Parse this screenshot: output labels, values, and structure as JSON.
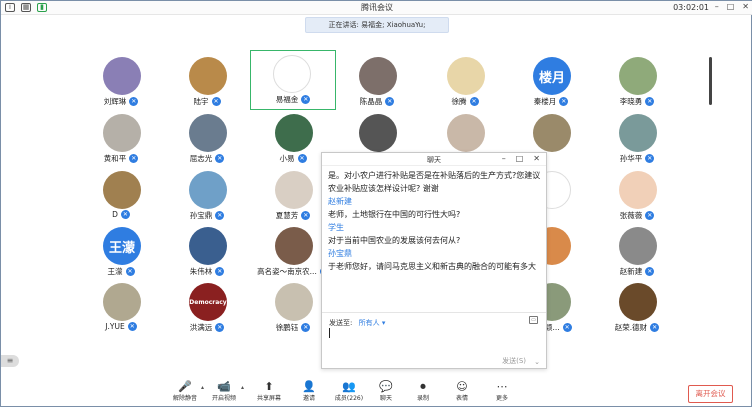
{
  "window": {
    "title": "腾讯会议",
    "time": "03:02:01"
  },
  "speaking_banner": "正在讲话: 易福金; XiaohuaYu;",
  "colors": {
    "accent": "#2f7de1",
    "active_border": "#38b66a",
    "leave_red": "#e05a4f"
  },
  "participants": [
    {
      "name": "刘辉琳",
      "bg": "#8a7fb5",
      "label": ""
    },
    {
      "name": "陆宇",
      "bg": "#b98a4a",
      "label": ""
    },
    {
      "name": "易福金",
      "bg": "#ffffff",
      "label": "",
      "active": true
    },
    {
      "name": "陈晶晶",
      "bg": "#7d6f6a",
      "label": ""
    },
    {
      "name": "徐腾",
      "bg": "#e8d6a8",
      "label": ""
    },
    {
      "name": "秦楼月",
      "bg": "#2f7de1",
      "label": "楼月"
    },
    {
      "name": "李晓勇",
      "bg": "#8faa7a",
      "label": ""
    },
    {
      "name": "黄和平",
      "bg": "#b5b0a8",
      "label": ""
    },
    {
      "name": "屈志光",
      "bg": "#6a7c8f",
      "label": ""
    },
    {
      "name": "小易",
      "bg": "#3e6d4c",
      "label": ""
    },
    {
      "name": "",
      "bg": "#555555",
      "label": ""
    },
    {
      "name": "",
      "bg": "#c9b8a8",
      "label": ""
    },
    {
      "name": "",
      "bg": "#9a8a6a",
      "label": ""
    },
    {
      "name": "孙华平",
      "bg": "#7a9a9a",
      "label": ""
    },
    {
      "name": "D",
      "bg": "#a08050",
      "label": ""
    },
    {
      "name": "孙宝鼎",
      "bg": "#6fa0c8",
      "label": ""
    },
    {
      "name": "夏慧芳",
      "bg": "#d9cfc4",
      "label": ""
    },
    {
      "name": "",
      "bg": "#ffffff",
      "label": ""
    },
    {
      "name": "",
      "bg": "#ffffff",
      "label": ""
    },
    {
      "name": "",
      "bg": "#ffffff",
      "label": ""
    },
    {
      "name": "张薇薇",
      "bg": "#f1d0b8",
      "label": ""
    },
    {
      "name": "王濛",
      "bg": "#2f7de1",
      "label": "王濛"
    },
    {
      "name": "朱伟林",
      "bg": "#3a5f8f",
      "label": ""
    },
    {
      "name": "高名姿～南京农...",
      "bg": "#7a5c4a",
      "label": ""
    },
    {
      "name": "",
      "bg": "#ffffff",
      "label": ""
    },
    {
      "name": "",
      "bg": "#ffffff",
      "label": ""
    },
    {
      "name": "",
      "bg": "#d98a4a",
      "label": ""
    },
    {
      "name": "赵新建",
      "bg": "#8a8a8a",
      "label": ""
    },
    {
      "name": "J.YUE",
      "bg": "#b0a890",
      "label": ""
    },
    {
      "name": "洪满远",
      "bg": "#8a2020",
      "label": "Democracy"
    },
    {
      "name": "徐鹏钰",
      "bg": "#c8c0b0",
      "label": ""
    },
    {
      "name": "",
      "bg": "#ffffff",
      "label": ""
    },
    {
      "name": "",
      "bg": "#ffffff",
      "label": ""
    },
    {
      "name": "...彰颖...",
      "bg": "#8a9a7a",
      "label": ""
    },
    {
      "name": "赵荣.德财",
      "bg": "#6a4a2a",
      "label": ""
    }
  ],
  "chat": {
    "title": "聊天",
    "messages": [
      {
        "sender": "",
        "text": "是。对小农户进行补贴是否是在补贴落后的生产方式?您建议农业补贴应该怎样设计呢? 谢谢"
      },
      {
        "sender": "赵新建",
        "text": "老师，土地银行在中国的可行性大吗?"
      },
      {
        "sender": "学生",
        "text": "对于当前中国农业的发展该何去何从?"
      },
      {
        "sender": "孙宝鼎",
        "text": "于老师您好，请问马克思主义和新古典的融合的可能有多大"
      }
    ],
    "send_to_label": "发送至:",
    "send_to_value": "所有人",
    "send_button": "发送(S)"
  },
  "toolbar": [
    {
      "label": "解除静音",
      "icon": "mic-muted-icon"
    },
    {
      "label": "开启视频",
      "icon": "video-off-icon"
    },
    {
      "label": "共享屏幕",
      "icon": "share-screen-icon"
    },
    {
      "label": "邀请",
      "icon": "invite-icon"
    },
    {
      "label": "成员(226)",
      "icon": "members-icon"
    },
    {
      "label": "聊天",
      "icon": "chat-icon"
    },
    {
      "label": "录制",
      "icon": "record-icon"
    },
    {
      "label": "表情",
      "icon": "emoji-icon"
    },
    {
      "label": "更多",
      "icon": "more-icon"
    }
  ],
  "leave_button": "离开会议"
}
